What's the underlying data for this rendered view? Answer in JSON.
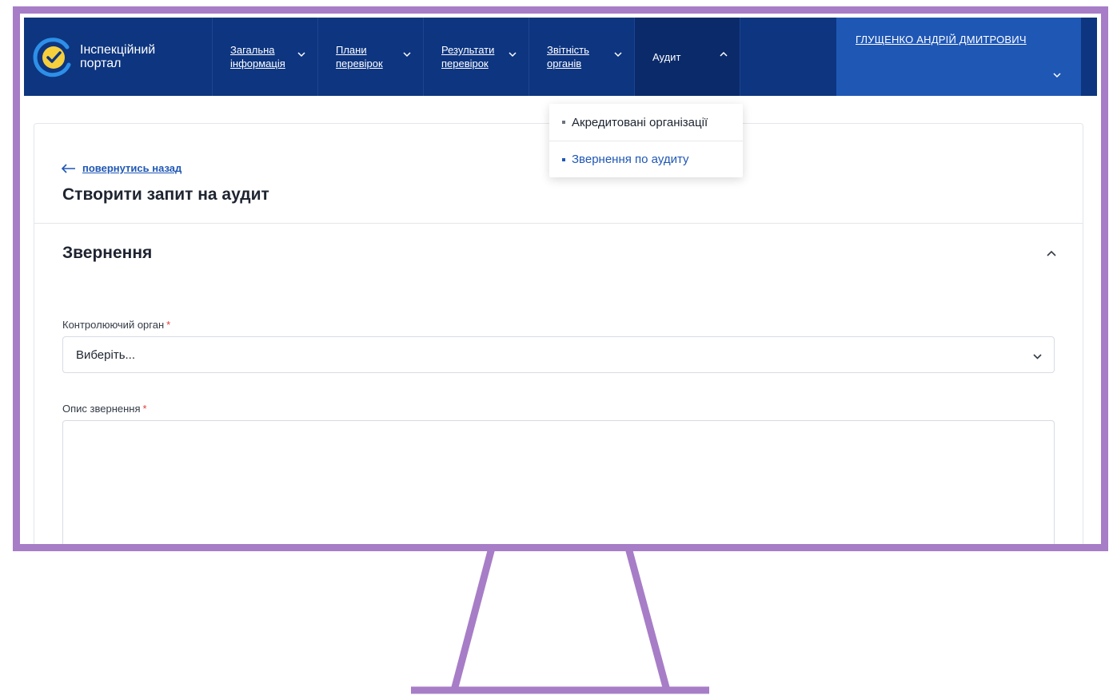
{
  "brand": {
    "name_line1": "Інспекційний",
    "name_line2": "портал",
    "logo_icon": "check-circle-icon"
  },
  "nav": {
    "items": [
      {
        "label": "Загальна інформація"
      },
      {
        "label": "Плани перевірок"
      },
      {
        "label": "Результати перевірок"
      },
      {
        "label": "Звітність органів"
      },
      {
        "label": "Аудит"
      }
    ]
  },
  "user": {
    "name": "ГЛУЩЕНКО АНДРІЙ ДМИТРОВИЧ"
  },
  "dropdown": {
    "items": [
      {
        "label": "Акредитовані організації"
      },
      {
        "label": "Звернення по аудиту"
      }
    ]
  },
  "page": {
    "back_label": "повернутись назад",
    "title": "Створити запит на аудит"
  },
  "section": {
    "title": "Звернення"
  },
  "form": {
    "authority_label": "Контролюючий орган",
    "authority_value": "Виберіть...",
    "description_label": "Опис звернення",
    "required_mark": "*"
  },
  "colors": {
    "nav_bg": "#0d3580",
    "user_bg": "#1f57b5",
    "accent": "#1f57b5",
    "frame": "#a77dc7",
    "required": "#e53b3b"
  }
}
